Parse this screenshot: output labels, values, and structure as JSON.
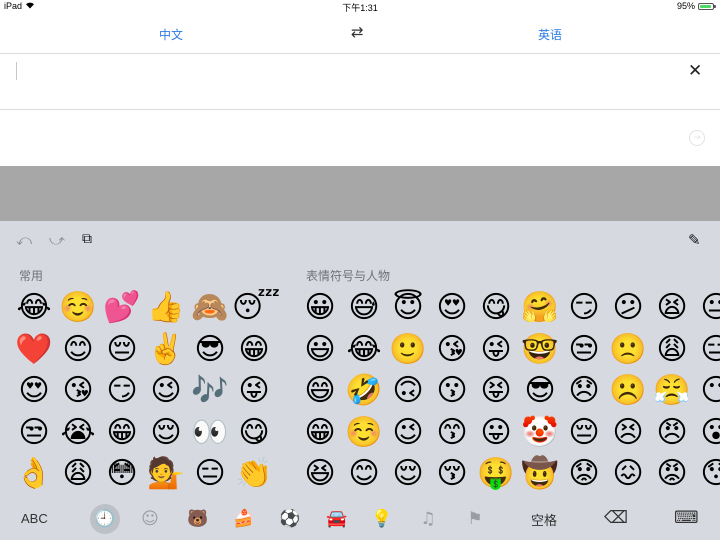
{
  "status_bar": {
    "device": "iPad",
    "time": "下午1:31",
    "battery_text": "95%",
    "battery_level": 0.95,
    "battery_color": "#4cd964"
  },
  "language_bar": {
    "source_language": "中文",
    "target_language": "英语",
    "swap_icon": "⇄",
    "accent_color": "#2c7be5"
  },
  "input": {
    "value": "",
    "clear_icon": "✕",
    "submit_icon": "→"
  },
  "keyboard": {
    "tools": {
      "undo": "⤺",
      "redo": "⤻",
      "paste": "⧉",
      "pen": "✎"
    },
    "recent_label": "常用",
    "people_label": "表情符号与人物",
    "recent_emojis": [
      "😂",
      "☺️",
      "💕",
      "👍",
      "🙈",
      "😴",
      "❤️",
      "😊",
      "😔",
      "✌️",
      "😎",
      "😁",
      "😍",
      "😘",
      "😏",
      "😉",
      "🎶",
      "😜",
      "😒",
      "😭",
      "😁",
      "😌",
      "👀",
      "😋",
      "👌",
      "😩",
      "😳",
      "💁",
      "😑",
      "👏"
    ],
    "people_emojis": [
      "😀",
      "😅",
      "😇",
      "😍",
      "😋",
      "🤗",
      "😏",
      "😕",
      "😫",
      "😐",
      "😃",
      "😂",
      "🙂",
      "😘",
      "😜",
      "🤓",
      "😒",
      "🙁",
      "😩",
      "😑",
      "😄",
      "🤣",
      "🙃",
      "😗",
      "😝",
      "😎",
      "😞",
      "☹️",
      "😤",
      "😶",
      "😁",
      "☺️",
      "😉",
      "😙",
      "😛",
      "🤡",
      "😔",
      "😣",
      "😠",
      "😮",
      "😆",
      "😊",
      "😌",
      "😚",
      "🤑",
      "🤠",
      "😟",
      "😖",
      "😡",
      "😯"
    ],
    "bottom": {
      "abc_label": "ABC",
      "space_label": "空格",
      "backspace_icon": "⌫",
      "hide_keyboard_icon": "⌨",
      "categories": [
        {
          "name": "recent",
          "icon": "🕘"
        },
        {
          "name": "smileys",
          "icon": "☺"
        },
        {
          "name": "animals",
          "icon": "🐻"
        },
        {
          "name": "food",
          "icon": "🍰"
        },
        {
          "name": "activity",
          "icon": "⚽"
        },
        {
          "name": "travel",
          "icon": "🚘"
        },
        {
          "name": "objects",
          "icon": "💡"
        },
        {
          "name": "symbols",
          "icon": "♫"
        },
        {
          "name": "flags",
          "icon": "⚑"
        }
      ]
    }
  }
}
